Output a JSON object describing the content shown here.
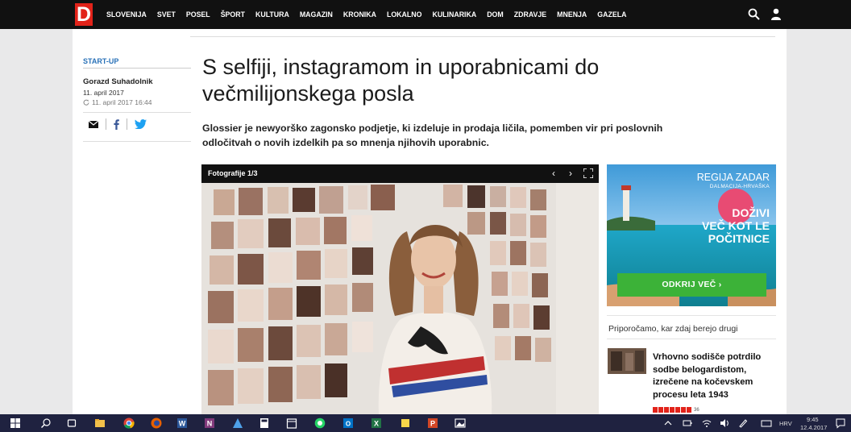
{
  "site": {
    "logo": "D",
    "nav": [
      "SLOVENIJA",
      "SVET",
      "POSEL",
      "ŠPORT",
      "KULTURA",
      "MAGAZIN",
      "KRONIKA",
      "LOKALNO",
      "KULINARIKA",
      "DOM",
      "ZDRAVJE",
      "MNENJA",
      "GAZELA"
    ],
    "accent": "#e2231a"
  },
  "article": {
    "section": "START-UP",
    "author": "Gorazd Suhadolnik",
    "published": "11. april 2017",
    "updated": "11. april 2017 16:44",
    "headline": "S selfiji, instagramom in uporabnicami do večmilijonskega posla",
    "lead": "Glossier je newyorško zagonsko podjetje, ki izdeluje in prodaja ličila, pomemben vir pri poslovnih odločitvah o novih izdelkih pa so mnenja njihovih uporabnic.",
    "share_icons": [
      "mail-icon",
      "facebook-icon",
      "twitter-icon"
    ]
  },
  "gallery": {
    "label": "Fotografije 1/3",
    "prev": "‹",
    "next": "›"
  },
  "ad": {
    "brand": "REGIJA ZADAR",
    "brand_sub": "DALMACIJA-HRVAŠKA",
    "slogan_line1": "DOŽIVI",
    "slogan_line2": "VEČ KOT LE",
    "slogan_line3": "POČITNICE",
    "button": "ODKRIJ VEČ  ›"
  },
  "recommended": {
    "title": "Priporočamo, kar zdaj berejo drugi",
    "items": [
      {
        "headline": "Vrhovno sodišče potrdilo sodbe belogardistom, izrečene na kočevskem procesu leta 1943",
        "rating_count": "36"
      }
    ]
  },
  "taskbar": {
    "language": "HRV",
    "time": "9:45",
    "date": "12.4.2017"
  }
}
